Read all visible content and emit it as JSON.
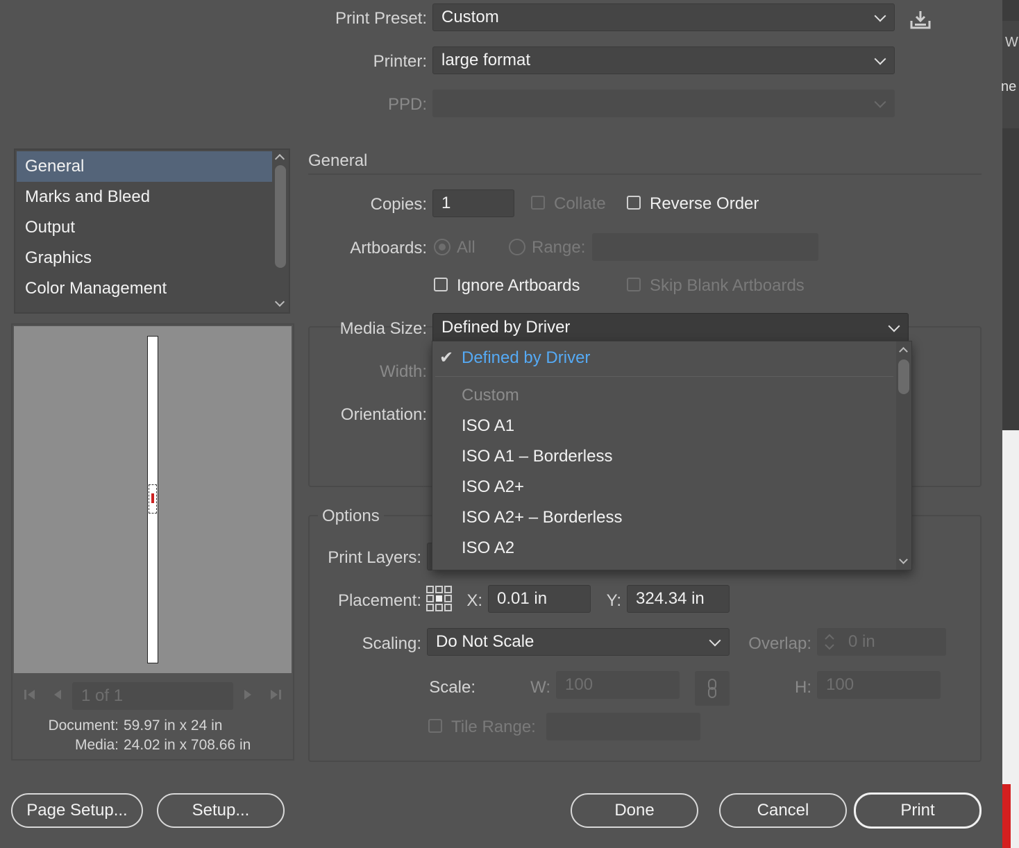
{
  "print_preset": {
    "label": "Print Preset:",
    "value": "Custom"
  },
  "printer": {
    "label": "Printer:",
    "value": "large format"
  },
  "ppd": {
    "label": "PPD:",
    "value": ""
  },
  "edge_text": {
    "top": "W:",
    "mid": "ne"
  },
  "categories": {
    "items": [
      {
        "label": "General",
        "selected": true
      },
      {
        "label": "Marks and Bleed",
        "selected": false
      },
      {
        "label": "Output",
        "selected": false
      },
      {
        "label": "Graphics",
        "selected": false
      },
      {
        "label": "Color Management",
        "selected": false
      }
    ]
  },
  "general": {
    "heading": "General",
    "copies_label": "Copies:",
    "copies_value": "1",
    "collate_label": "Collate",
    "reverse_label": "Reverse Order",
    "artboards_label": "Artboards:",
    "all_label": "All",
    "range_label": "Range:",
    "ignore_artboards_label": "Ignore Artboards",
    "skip_blank_label": "Skip Blank Artboards"
  },
  "media": {
    "size_label": "Media Size:",
    "size_value": "Defined by Driver",
    "width_label": "Width:",
    "orientation_label": "Orientation:"
  },
  "dropdown": {
    "checked_item": "Defined by Driver",
    "items": [
      "Custom",
      "ISO A1",
      "ISO A1 – Borderless",
      "ISO A2+",
      "ISO A2+ – Borderless",
      "ISO A2"
    ],
    "dim_items": [
      "Custom"
    ]
  },
  "options": {
    "heading": "Options",
    "print_layers_label": "Print Layers:",
    "placement_label": "Placement:",
    "x_label": "X:",
    "x_value": "0.01 in",
    "y_label": "Y:",
    "y_value": "324.34 in",
    "scaling_label": "Scaling:",
    "scaling_value": "Do Not Scale",
    "overlap_label": "Overlap:",
    "overlap_value": "0 in",
    "scale_label": "Scale:",
    "w_label": "W:",
    "w_value": "100",
    "h_label": "H:",
    "h_value": "100",
    "tile_range_label": "Tile Range:"
  },
  "preview": {
    "page_counter": "1 of 1",
    "document_label": "Document:",
    "document_value": "59.97 in x 24 in",
    "media_label": "Media:",
    "media_value": "24.02 in x 708.66 in"
  },
  "buttons": {
    "page_setup": "Page Setup...",
    "setup": "Setup...",
    "done": "Done",
    "cancel": "Cancel",
    "print": "Print"
  },
  "colors": {
    "background": "#535353",
    "selection": "#546479",
    "checked_item": "#55aaf5",
    "accent_red": "#d42020"
  }
}
